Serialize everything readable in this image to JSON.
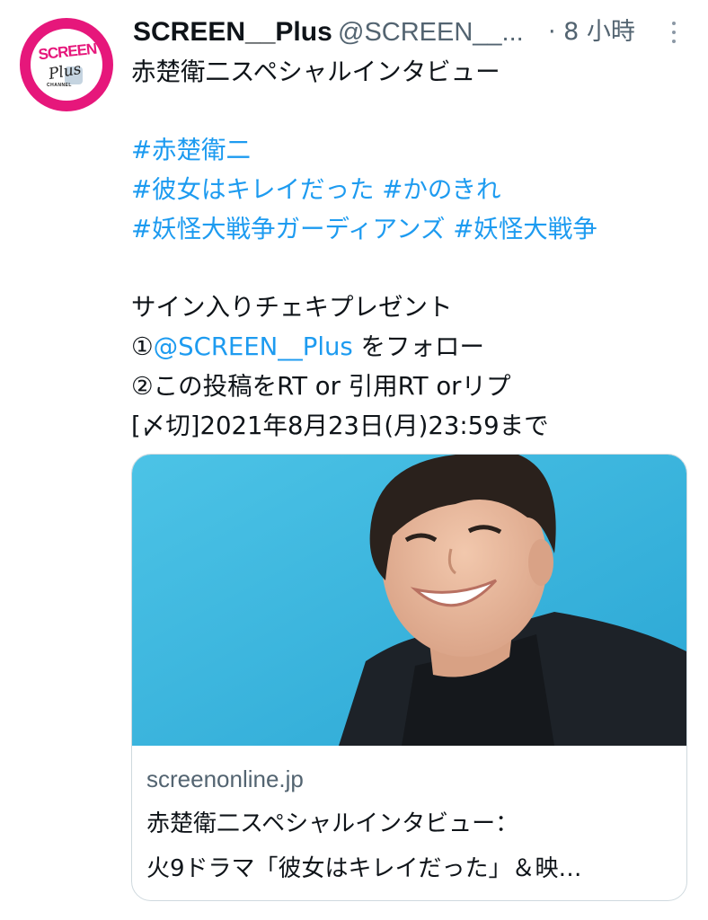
{
  "author": {
    "display_name": "SCREEN__Plus",
    "handle": "@SCREEN__...",
    "timestamp": "· 8 小時",
    "avatar": {
      "logo_text": "SCREEN",
      "logo_sub": "Plus",
      "logo_channel": "CHANNEL",
      "ring_color": "#e6177b"
    }
  },
  "more_icon": "more-vertical-icon",
  "tweet": {
    "line1": "赤楚衛二スペシャルインタビュー",
    "hashtags_line1": [
      "#赤楚衛二"
    ],
    "hashtags_line2": [
      "#彼女はキレイだった",
      "#かのきれ"
    ],
    "hashtags_line3": [
      "#妖怪大戦争ガーディアンズ",
      "#妖怪大戦争"
    ],
    "present_title": "サイン入りチェキプレゼント",
    "step1_prefix": "①",
    "step1_mention": "@SCREEN__Plus",
    "step1_suffix": " をフォロー",
    "step2": "②この投稿をRT or 引用RT orリプ",
    "deadline": "[〆切]2021年8月23日(月)23:59まで"
  },
  "card": {
    "domain": "screenonline.jp",
    "title": "赤楚衛二スペシャルインタビュー：",
    "description": "火9ドラマ「彼女はキレイだった」＆映…"
  },
  "colors": {
    "link": "#1d9bf0",
    "text": "#0f1419",
    "muted": "#536471",
    "card_border": "#cfd9de",
    "photo_bg": "#3ab6dc"
  }
}
